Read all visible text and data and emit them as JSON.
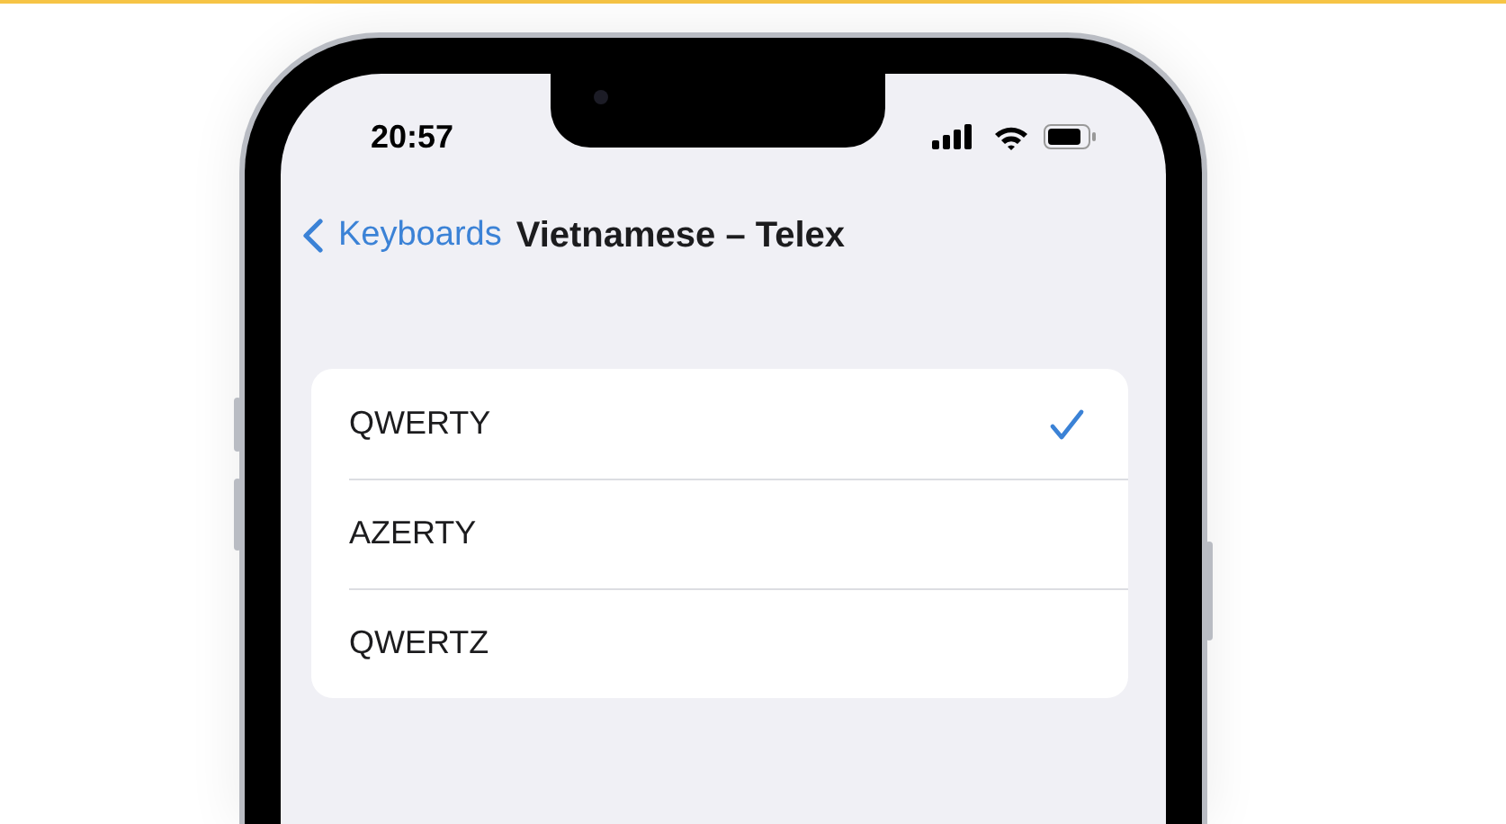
{
  "status_bar": {
    "time": "20:57"
  },
  "nav_bar": {
    "back_label": "Keyboards",
    "title": "Vietnamese – Telex"
  },
  "layouts": [
    {
      "label": "QWERTY",
      "selected": true
    },
    {
      "label": "AZERTY",
      "selected": false
    },
    {
      "label": "QWERTZ",
      "selected": false
    }
  ]
}
